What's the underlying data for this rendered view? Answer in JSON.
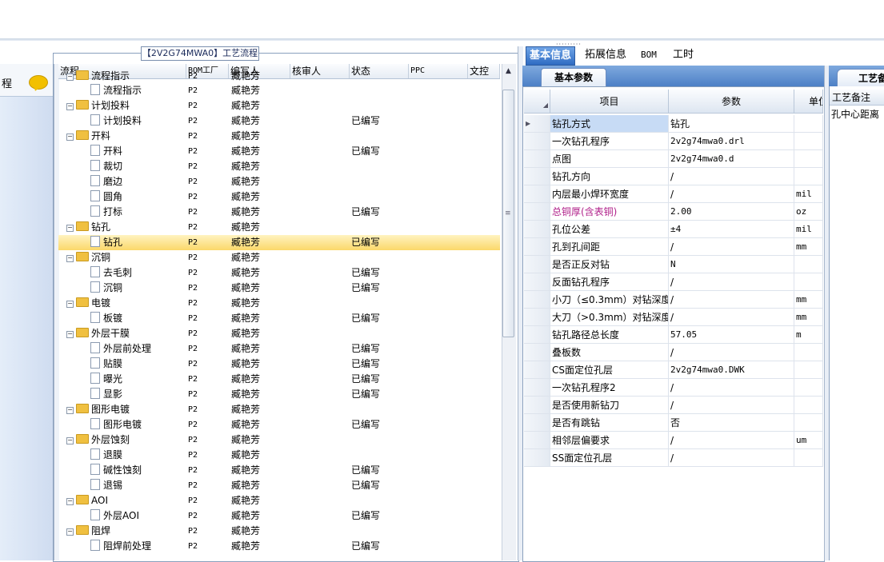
{
  "left_panel": {
    "label": "程",
    "icon": "speech-bubble-icon"
  },
  "center": {
    "title": "【2V2G74MWA0】工艺流程",
    "columns": [
      "流程",
      "BOM工厂",
      "编写人",
      "核审人",
      "状态",
      "PPC",
      "文控"
    ],
    "rows": [
      {
        "name": "流程指示",
        "level": 0,
        "factory": "P2",
        "writer": "臧艳芳",
        "status": "",
        "partial": true
      },
      {
        "name": "流程指示",
        "level": 1,
        "factory": "P2",
        "writer": "臧艳芳",
        "status": ""
      },
      {
        "name": "计划投料",
        "level": 0,
        "factory": "P2",
        "writer": "臧艳芳",
        "status": ""
      },
      {
        "name": "计划投料",
        "level": 1,
        "factory": "P2",
        "writer": "臧艳芳",
        "status": "已编写"
      },
      {
        "name": "开料",
        "level": 0,
        "factory": "P2",
        "writer": "臧艳芳",
        "status": ""
      },
      {
        "name": "开料",
        "level": 1,
        "factory": "P2",
        "writer": "臧艳芳",
        "status": "已编写"
      },
      {
        "name": "裁切",
        "level": 1,
        "factory": "P2",
        "writer": "臧艳芳",
        "status": ""
      },
      {
        "name": "磨边",
        "level": 1,
        "factory": "P2",
        "writer": "臧艳芳",
        "status": ""
      },
      {
        "name": "圆角",
        "level": 1,
        "factory": "P2",
        "writer": "臧艳芳",
        "status": ""
      },
      {
        "name": "打标",
        "level": 1,
        "factory": "P2",
        "writer": "臧艳芳",
        "status": "已编写"
      },
      {
        "name": "钻孔",
        "level": 0,
        "factory": "P2",
        "writer": "臧艳芳",
        "status": ""
      },
      {
        "name": "钻孔",
        "level": 1,
        "factory": "P2",
        "writer": "臧艳芳",
        "status": "已编写",
        "selected": true
      },
      {
        "name": "沉铜",
        "level": 0,
        "factory": "P2",
        "writer": "臧艳芳",
        "status": ""
      },
      {
        "name": "去毛刺",
        "level": 1,
        "factory": "P2",
        "writer": "臧艳芳",
        "status": "已编写"
      },
      {
        "name": "沉铜",
        "level": 1,
        "factory": "P2",
        "writer": "臧艳芳",
        "status": "已编写"
      },
      {
        "name": "电镀",
        "level": 0,
        "factory": "P2",
        "writer": "臧艳芳",
        "status": ""
      },
      {
        "name": "板镀",
        "level": 1,
        "factory": "P2",
        "writer": "臧艳芳",
        "status": "已编写"
      },
      {
        "name": "外层干膜",
        "level": 0,
        "factory": "P2",
        "writer": "臧艳芳",
        "status": ""
      },
      {
        "name": "外层前处理",
        "level": 1,
        "factory": "P2",
        "writer": "臧艳芳",
        "status": "已编写"
      },
      {
        "name": "贴膜",
        "level": 1,
        "factory": "P2",
        "writer": "臧艳芳",
        "status": "已编写"
      },
      {
        "name": "曝光",
        "level": 1,
        "factory": "P2",
        "writer": "臧艳芳",
        "status": "已编写"
      },
      {
        "name": "显影",
        "level": 1,
        "factory": "P2",
        "writer": "臧艳芳",
        "status": "已编写"
      },
      {
        "name": "图形电镀",
        "level": 0,
        "factory": "P2",
        "writer": "臧艳芳",
        "status": ""
      },
      {
        "name": "图形电镀",
        "level": 1,
        "factory": "P2",
        "writer": "臧艳芳",
        "status": "已编写"
      },
      {
        "name": "外层蚀刻",
        "level": 0,
        "factory": "P2",
        "writer": "臧艳芳",
        "status": ""
      },
      {
        "name": "退膜",
        "level": 1,
        "factory": "P2",
        "writer": "臧艳芳",
        "status": ""
      },
      {
        "name": "碱性蚀刻",
        "level": 1,
        "factory": "P2",
        "writer": "臧艳芳",
        "status": "已编写"
      },
      {
        "name": "退锡",
        "level": 1,
        "factory": "P2",
        "writer": "臧艳芳",
        "status": "已编写"
      },
      {
        "name": "AOI",
        "level": 0,
        "factory": "P2",
        "writer": "臧艳芳",
        "status": ""
      },
      {
        "name": "外层AOI",
        "level": 1,
        "factory": "P2",
        "writer": "臧艳芳",
        "status": "已编写"
      },
      {
        "name": "阻焊",
        "level": 0,
        "factory": "P2",
        "writer": "臧艳芳",
        "status": ""
      },
      {
        "name": "阻焊前处理",
        "level": 1,
        "factory": "P2",
        "writer": "臧艳芳",
        "status": "已编写"
      }
    ]
  },
  "right": {
    "tabs": [
      "基本信息",
      "拓展信息",
      "BOM",
      "工时"
    ],
    "active_tab": "基本信息",
    "subtab": "基本参数",
    "grid_columns": [
      "项目",
      "参数",
      "单位"
    ],
    "rows": [
      {
        "item": "钻孔方式",
        "param": "钻孔",
        "unit": "",
        "current": true
      },
      {
        "item": "一次钻孔程序",
        "param": "2v2g74mwa0.drl",
        "unit": ""
      },
      {
        "item": "点图",
        "param": "2v2g74mwa0.d",
        "unit": ""
      },
      {
        "item": "钻孔方向",
        "param": "/",
        "unit": ""
      },
      {
        "item": "内层最小焊环宽度",
        "param": "/",
        "unit": "mil"
      },
      {
        "item": "总铜厚(含表铜)",
        "param": "2.00",
        "unit": "oz",
        "highlight": true
      },
      {
        "item": "孔位公差",
        "param": "±4",
        "unit": "mil"
      },
      {
        "item": "孔到孔间距",
        "param": "/",
        "unit": "mm"
      },
      {
        "item": "是否正反对钻",
        "param": "N",
        "unit": ""
      },
      {
        "item": "反面钻孔程序",
        "param": "/",
        "unit": ""
      },
      {
        "item": "小刀（≤0.3mm）对钻深度",
        "param": "/",
        "unit": "mm"
      },
      {
        "item": "大刀（>0.3mm）对钻深度",
        "param": "/",
        "unit": "mm"
      },
      {
        "item": "钻孔路径总长度",
        "param": "57.05",
        "unit": "m"
      },
      {
        "item": "叠板数",
        "param": "/",
        "unit": ""
      },
      {
        "item": "CS面定位孔层",
        "param": "2v2g74mwa0.DWK",
        "unit": ""
      },
      {
        "item": "一次钻孔程序2",
        "param": "/",
        "unit": ""
      },
      {
        "item": "是否使用新钻刀",
        "param": "/",
        "unit": ""
      },
      {
        "item": "是否有跳钻",
        "param": "否",
        "unit": ""
      },
      {
        "item": "相邻层偏要求",
        "param": "/",
        "unit": "um"
      },
      {
        "item": "SS面定位孔层",
        "param": "/",
        "unit": ""
      }
    ],
    "highlight_color": "#b0208a",
    "selection_color": "#fbd86a"
  },
  "far_right": {
    "tab": "工艺备注",
    "header": "工艺备注",
    "text": "孔中心距离"
  }
}
